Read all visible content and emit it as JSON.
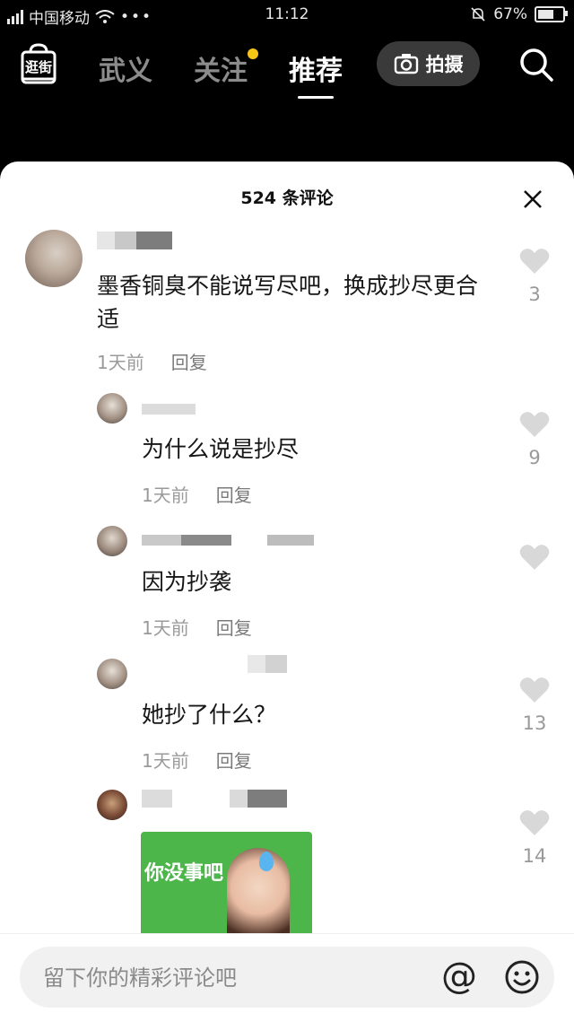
{
  "status": {
    "carrier": "中国移动",
    "time": "11:12",
    "battery": "67%",
    "battery_level": 0.67
  },
  "nav": {
    "tabs": [
      "武义",
      "关注",
      "推荐"
    ],
    "active_tab": "推荐",
    "shoot_label": "拍摄",
    "logo_text": "逛街"
  },
  "sheet": {
    "title": "524 条评论"
  },
  "comments": [
    {
      "text": "墨香铜臭不能说写尽吧，换成抄尽更合适",
      "time": "1天前",
      "reply": "回复",
      "likes": "3"
    },
    {
      "text": "为什么说是抄尽",
      "time": "1天前",
      "reply": "回复",
      "likes": "9"
    },
    {
      "text": "因为抄袭",
      "time": "1天前",
      "reply": "回复",
      "likes": ""
    },
    {
      "text": "她抄了什么？",
      "time": "1天前",
      "reply": "回复",
      "likes": "13"
    },
    {
      "sticker_text": "你没事吧",
      "likes": "14"
    }
  ],
  "input": {
    "placeholder": "留下你的精彩评论吧",
    "at_symbol": "@"
  }
}
